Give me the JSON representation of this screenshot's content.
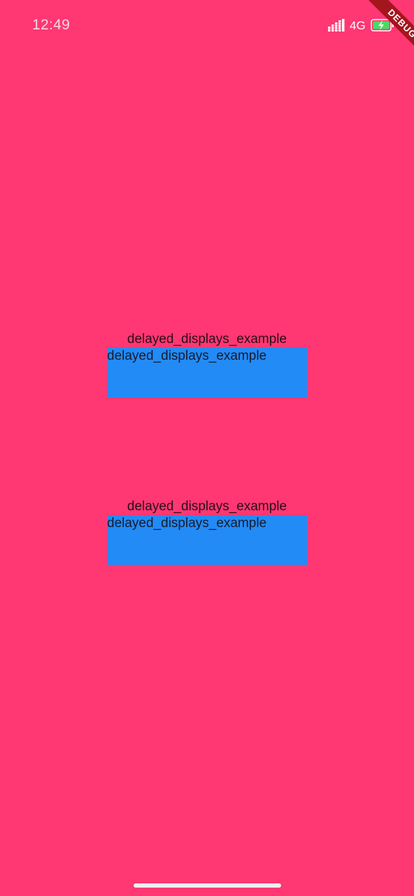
{
  "status_bar": {
    "time": "12:49",
    "network": "4G",
    "icons": [
      "signal-icon",
      "battery-charging-icon"
    ]
  },
  "debug_banner": {
    "label": "DEBUG"
  },
  "sections": [
    {
      "label": "delayed_displays_example",
      "panel_text": "delayed_displays_example"
    },
    {
      "label": "delayed_displays_example",
      "panel_text": "delayed_displays_example"
    }
  ],
  "colors": {
    "background": "#FF3773",
    "panel": "#228BF6",
    "debug_ribbon": "#A4161E",
    "battery_fill": "#4CD964"
  }
}
